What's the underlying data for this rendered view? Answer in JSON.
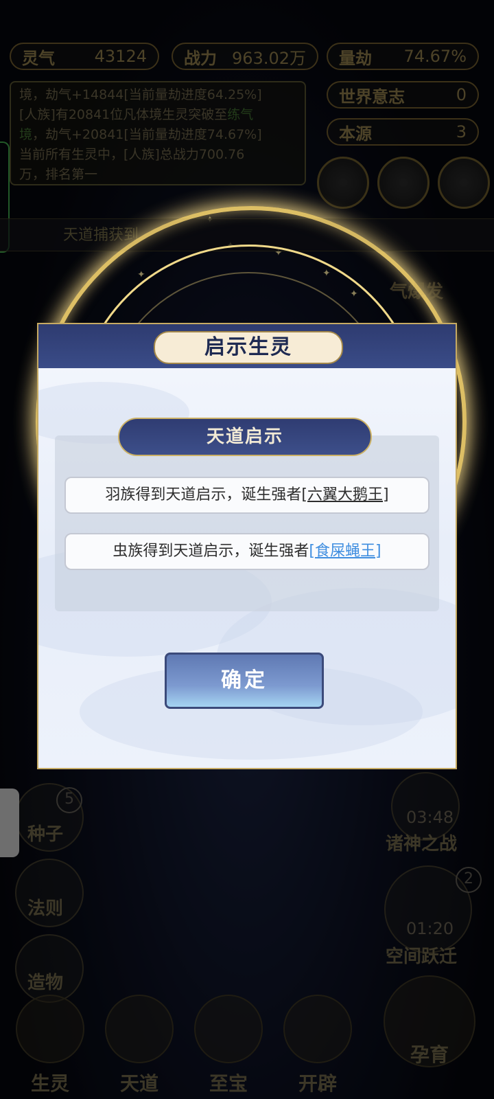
{
  "stats": {
    "lingqi": {
      "label": "灵气",
      "value": "43124"
    },
    "zhanli": {
      "label": "战力",
      "value": "963.02万"
    },
    "liangjie": {
      "label": "量劫",
      "value": "74.67%"
    },
    "world_will": {
      "label": "世界意志",
      "value": "0"
    },
    "benyuan": {
      "label": "本源",
      "value": "3"
    }
  },
  "log": {
    "line1": "境，劫气+14844[当前量劫进度64.25%]",
    "line2_pre": "[人族]有20841位凡体境生灵突破至",
    "line2_green": "练气",
    "line3_green": "境",
    "line3_post": "，劫气+20841[当前量劫进度74.67%]",
    "line4": "当前所有生灵中，[人族]总战力700.76",
    "line5": "万，排名第一"
  },
  "capture_text": "天道捕获到",
  "burst_label": "气爆发",
  "side": {
    "seed": "种子",
    "seed_badge": "5",
    "law": "法则",
    "create": "造物",
    "gods_war": "诸神之战",
    "gods_timer": "03:48",
    "space_jump": "空间跃迁",
    "space_timer": "01:20",
    "space_badge": "2"
  },
  "bottom_nav": [
    "生灵",
    "天道",
    "至宝",
    "开辟",
    "孕育"
  ],
  "dialog": {
    "title": "启示生灵",
    "subtitle": "天道启示",
    "items": [
      {
        "text": "羽族得到天道启示，诞生强者",
        "name": "[六翼大鹅王]",
        "color": "#2d2d2d"
      },
      {
        "text": "虫族得到天道启示，诞生强者",
        "name": "[食屎蝇王]",
        "color": "#3f8ee0"
      }
    ],
    "ok_label": "确定"
  }
}
